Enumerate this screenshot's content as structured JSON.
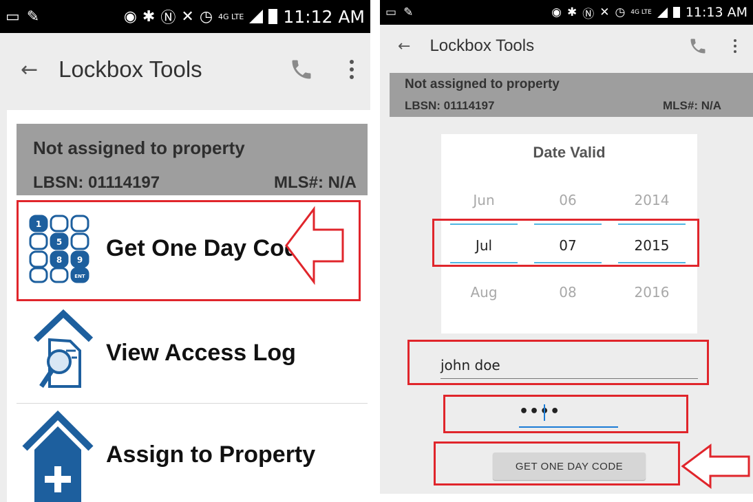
{
  "left": {
    "status": {
      "time": "11:12 AM",
      "net": "4G LTE"
    },
    "toolbar": {
      "title": "Lockbox Tools"
    },
    "info": {
      "title": "Not assigned to property",
      "lbsn": "LBSN: 01114197",
      "mls": "MLS#: N/A"
    },
    "menu": [
      {
        "label": "Get One Day Code",
        "icon": "keypad-icon"
      },
      {
        "label": "View Access Log",
        "icon": "access-log-icon"
      },
      {
        "label": "Assign to Property",
        "icon": "house-plus-icon"
      }
    ]
  },
  "right": {
    "status": {
      "time": "11:13 AM",
      "net": "4G LTE"
    },
    "toolbar": {
      "title": "Lockbox Tools"
    },
    "info": {
      "title": "Not assigned to property",
      "lbsn": "LBSN: 01114197",
      "mls": "MLS#: N/A"
    },
    "date_picker": {
      "title": "Date Valid",
      "month": {
        "prev": "Jun",
        "selected": "Jul",
        "next": "Aug"
      },
      "day": {
        "prev": "06",
        "selected": "07",
        "next": "08"
      },
      "year": {
        "prev": "2014",
        "selected": "2015",
        "next": "2016"
      }
    },
    "name_value": "john doe",
    "pin_value": "••••",
    "button_label": "GET ONE DAY CODE"
  },
  "colors": {
    "highlight": "#e0252b",
    "icon_blue": "#1d5f9e",
    "accent": "#4fb6e3"
  }
}
